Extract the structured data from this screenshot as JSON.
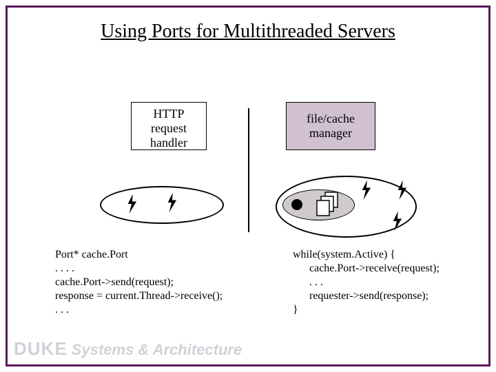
{
  "title": "Using Ports for Multithreaded Servers",
  "left_box": {
    "line1": "HTTP",
    "line2": "request",
    "line3": "handler"
  },
  "right_box": {
    "line1": "file/cache",
    "line2": "manager"
  },
  "code_left": "Port* cache.Port\n. . . .\ncache.Port->send(request);\nresponse = current.Thread->receive();\n. . .",
  "code_right": "while(system.Active) {\n      cache.Port->receive(request);\n      . . .\n      requester->send(response);\n}",
  "footer": {
    "brand": "DUKE",
    "sublabel": "Systems & Architecture"
  }
}
